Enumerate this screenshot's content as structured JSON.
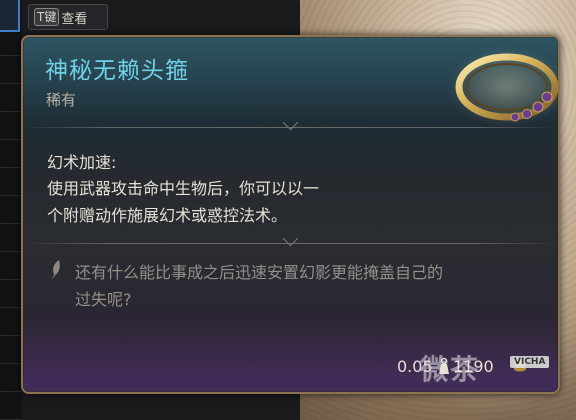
{
  "hint": {
    "key_label": "T键",
    "action_label": "查看"
  },
  "item": {
    "name": "神秘无赖头箍",
    "rarity": "稀有",
    "ability_name": "幻术加速:",
    "ability_desc_line1": "使用武器攻击命中生物后，你可以以一",
    "ability_desc_line2": "个附赠动作施展幻术或惑控法术。",
    "flavor_line1": "还有什么能比事成之后迅速安置幻影更能掩盖自己的",
    "flavor_line2": "过失呢?",
    "weight": "0.05",
    "price": "1190",
    "icon": "ring-circlet-icon"
  },
  "watermark": {
    "text": "微茶",
    "badge": "VICHA"
  },
  "colors": {
    "title": "#6fd1e6",
    "border": "#8b7352",
    "rarity": "#b7b2a7",
    "body_text": "#e6e1d4",
    "flavor_text": "#948f87"
  }
}
